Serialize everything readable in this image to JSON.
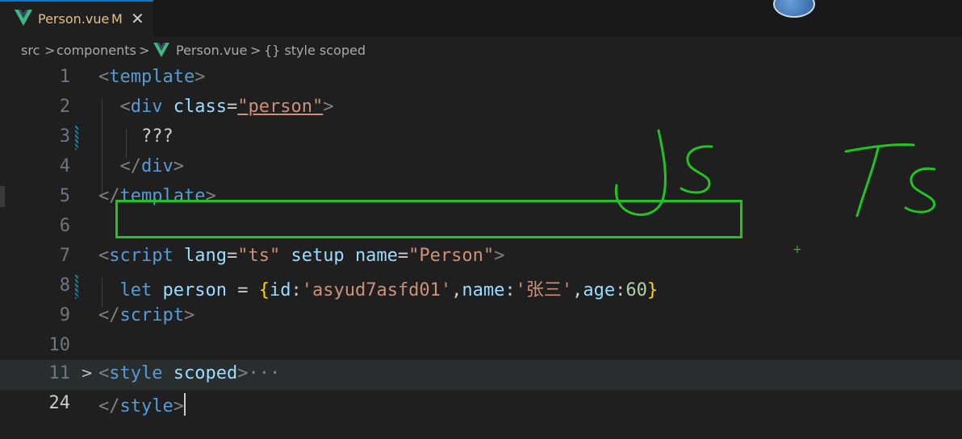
{
  "tab": {
    "file_name": "Person.vue",
    "modified_flag": "M",
    "close_glyph": "✕",
    "icon": "vue-icon"
  },
  "breadcrumb": {
    "items": [
      "src",
      "components",
      "Person.vue",
      "{} style scoped"
    ],
    "separator": ">"
  },
  "editor": {
    "line_numbers": [
      "1",
      "2",
      "3",
      "4",
      "5",
      "6",
      "7",
      "8",
      "9",
      "10",
      "11",
      "24"
    ],
    "active_line": "24",
    "fold_glyph": ">",
    "lines": {
      "l1": [
        "<",
        "template",
        ">"
      ],
      "l2": [
        "<",
        "div",
        "class",
        "=",
        "\"person\"",
        ">"
      ],
      "l3": [
        "???"
      ],
      "l4": [
        "</",
        "div",
        ">"
      ],
      "l5": [
        "</",
        "template",
        ">"
      ],
      "l7": [
        "<",
        "script",
        "lang",
        "=",
        "\"ts\"",
        "setup",
        "name",
        "=",
        "\"Person\"",
        ">"
      ],
      "l8": [
        "let",
        "person",
        "=",
        "{",
        "id",
        ":",
        "'asyud7asfd01'",
        ",",
        "name",
        ":",
        "'张三'",
        ",",
        "age",
        ":",
        "60",
        "}"
      ],
      "l9": [
        "</",
        "script",
        ">"
      ],
      "l11": [
        "<",
        "style",
        "scoped",
        ">",
        "···"
      ],
      "l24": [
        "</",
        "style",
        ">"
      ]
    }
  },
  "annotations": {
    "left_text": "Js",
    "right_text": "Ts",
    "color": "#22c322"
  },
  "colors": {
    "tag": "#569cd6",
    "attr": "#9cdcfe",
    "string": "#ce9178",
    "number": "#b5cea8",
    "brace": "#ffd700",
    "highlight_box": "#22c322"
  }
}
